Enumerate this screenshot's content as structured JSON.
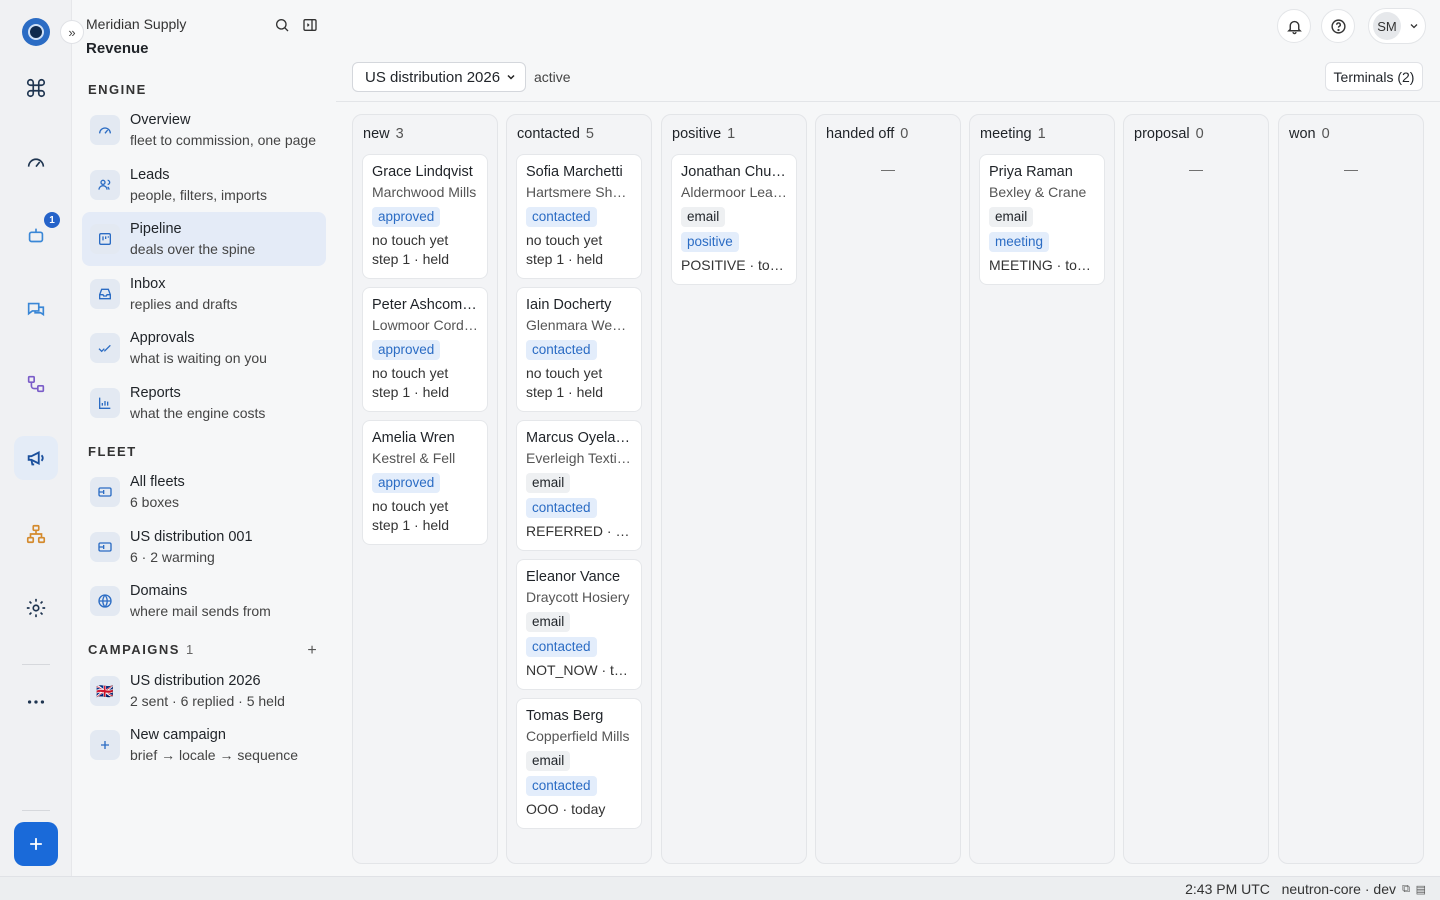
{
  "app": {
    "org": "Meridian Supply",
    "section": "Revenue"
  },
  "sidebar": {
    "groups": {
      "engine": "ENGINE",
      "fleet": "FLEET",
      "campaigns": "CAMPAIGNS",
      "campaigns_count": "1"
    },
    "engine": [
      {
        "title": "Overview",
        "sub": "fleet to commission, one page"
      },
      {
        "title": "Leads",
        "sub": "people, filters, imports"
      },
      {
        "title": "Pipeline",
        "sub": "deals over the spine"
      },
      {
        "title": "Inbox",
        "sub": "replies and drafts"
      },
      {
        "title": "Approvals",
        "sub": "what is waiting on you"
      },
      {
        "title": "Reports",
        "sub": "what the engine costs"
      }
    ],
    "fleet": [
      {
        "title": "All fleets",
        "sub": "6 boxes"
      },
      {
        "title": "US distribution 001",
        "sub": "6 · 2 warming"
      },
      {
        "title": "Domains",
        "sub": "where mail sends from"
      }
    ],
    "campaigns": [
      {
        "title": "US distribution 2026",
        "sub": "2 sent · 6 replied · 5 held",
        "flag": "🇬🇧"
      },
      {
        "title": "New campaign",
        "sub": "brief → locale → sequence"
      }
    ]
  },
  "rail": {
    "badge": "1"
  },
  "topbar": {
    "avatar": "SM"
  },
  "toolbar": {
    "campaign_select": "US distribution 2026",
    "status": "active",
    "terminals": "Terminals (2)"
  },
  "columns": [
    {
      "name": "new",
      "count": "3"
    },
    {
      "name": "contacted",
      "count": "5"
    },
    {
      "name": "positive",
      "count": "1"
    },
    {
      "name": "handed off",
      "count": "0",
      "empty": "—"
    },
    {
      "name": "meeting",
      "count": "1"
    },
    {
      "name": "proposal",
      "count": "0",
      "empty": "—"
    },
    {
      "name": "won",
      "count": "0",
      "empty": "—"
    }
  ],
  "cards": {
    "new": [
      {
        "name": "Grace Lindqvist",
        "company": "Marchwood Mills",
        "status": "approved",
        "line1": "no touch yet",
        "line2": "step 1 · held"
      },
      {
        "name": "Peter Ashcombe",
        "company": "Lowmoor Cordage",
        "status": "approved",
        "line1": "no touch yet",
        "line2": "step 1 · held"
      },
      {
        "name": "Amelia Wren",
        "company": "Kestrel & Fell",
        "status": "approved",
        "line1": "no touch yet",
        "line2": "step 1 · held"
      }
    ],
    "contacted": [
      {
        "name": "Sofia Marchetti",
        "company": "Hartsmere Shoes",
        "status": "contacted",
        "line1": "no touch yet",
        "line2": "step 1 · held"
      },
      {
        "name": "Iain Docherty",
        "company": "Glenmara Weavers",
        "status": "contacted",
        "line1": "no touch yet",
        "line2": "step 1 · held"
      },
      {
        "name": "Marcus Oyelaran",
        "company": "Everleigh Textiles",
        "channel": "email",
        "status": "contacted",
        "line1": "REFERRED · today"
      },
      {
        "name": "Eleanor Vance",
        "company": "Draycott Hosiery",
        "channel": "email",
        "status": "contacted",
        "line1": "NOT_NOW · today"
      },
      {
        "name": "Tomas Berg",
        "company": "Copperfield Mills",
        "channel": "email",
        "status": "contacted",
        "line1": "OOO · today"
      }
    ],
    "positive": [
      {
        "name": "Jonathan Chung",
        "company": "Aldermoor Leather",
        "channel": "email",
        "status": "positive",
        "line1": "POSITIVE · today"
      }
    ],
    "meeting": [
      {
        "name": "Priya Raman",
        "company": "Bexley & Crane",
        "channel": "email",
        "status": "meeting",
        "line1": "MEETING · today"
      }
    ]
  },
  "footer": {
    "time": "2:43 PM UTC",
    "env": "neutron-core · dev"
  },
  "colors": {
    "accent": "#1a6ad9",
    "pill_blue_bg": "#e3edfb",
    "pill_blue_fg": "#2b6cc4"
  }
}
